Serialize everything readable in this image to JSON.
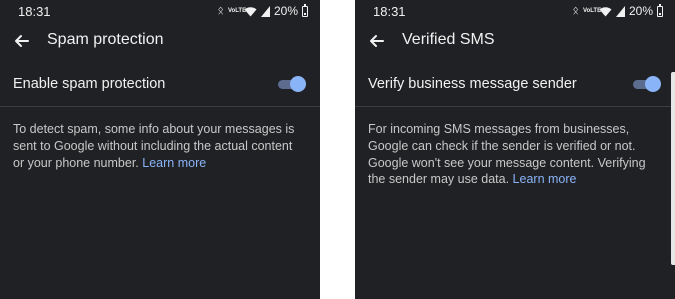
{
  "left": {
    "status": {
      "time": "18:31",
      "volte": "VoLTE",
      "battery": "20%"
    },
    "title": "Spam protection",
    "setting_label": "Enable spam protection",
    "toggle_on": true,
    "description": "To detect spam, some info about your messages is sent to Google without including the actual content or your phone number.",
    "learn_more": "Learn more"
  },
  "right": {
    "status": {
      "time": "18:31",
      "volte": "VoLTE",
      "battery": "20%"
    },
    "title": "Verified SMS",
    "setting_label": "Verify business message sender",
    "toggle_on": true,
    "description": "For incoming SMS messages from businesses, Google can check if the sender is verified or not. Google won't see your message content. Verifying the sender may use data.",
    "learn_more": "Learn more"
  },
  "colors": {
    "background": "#202124",
    "accent": "#8ab4f8",
    "toggle_track": "#5b6c8f",
    "divider": "#3c3d40"
  },
  "icons": [
    "back-arrow-icon",
    "bluetooth-icon",
    "volte-icon",
    "wifi-icon",
    "signal-icon",
    "battery-icon"
  ]
}
